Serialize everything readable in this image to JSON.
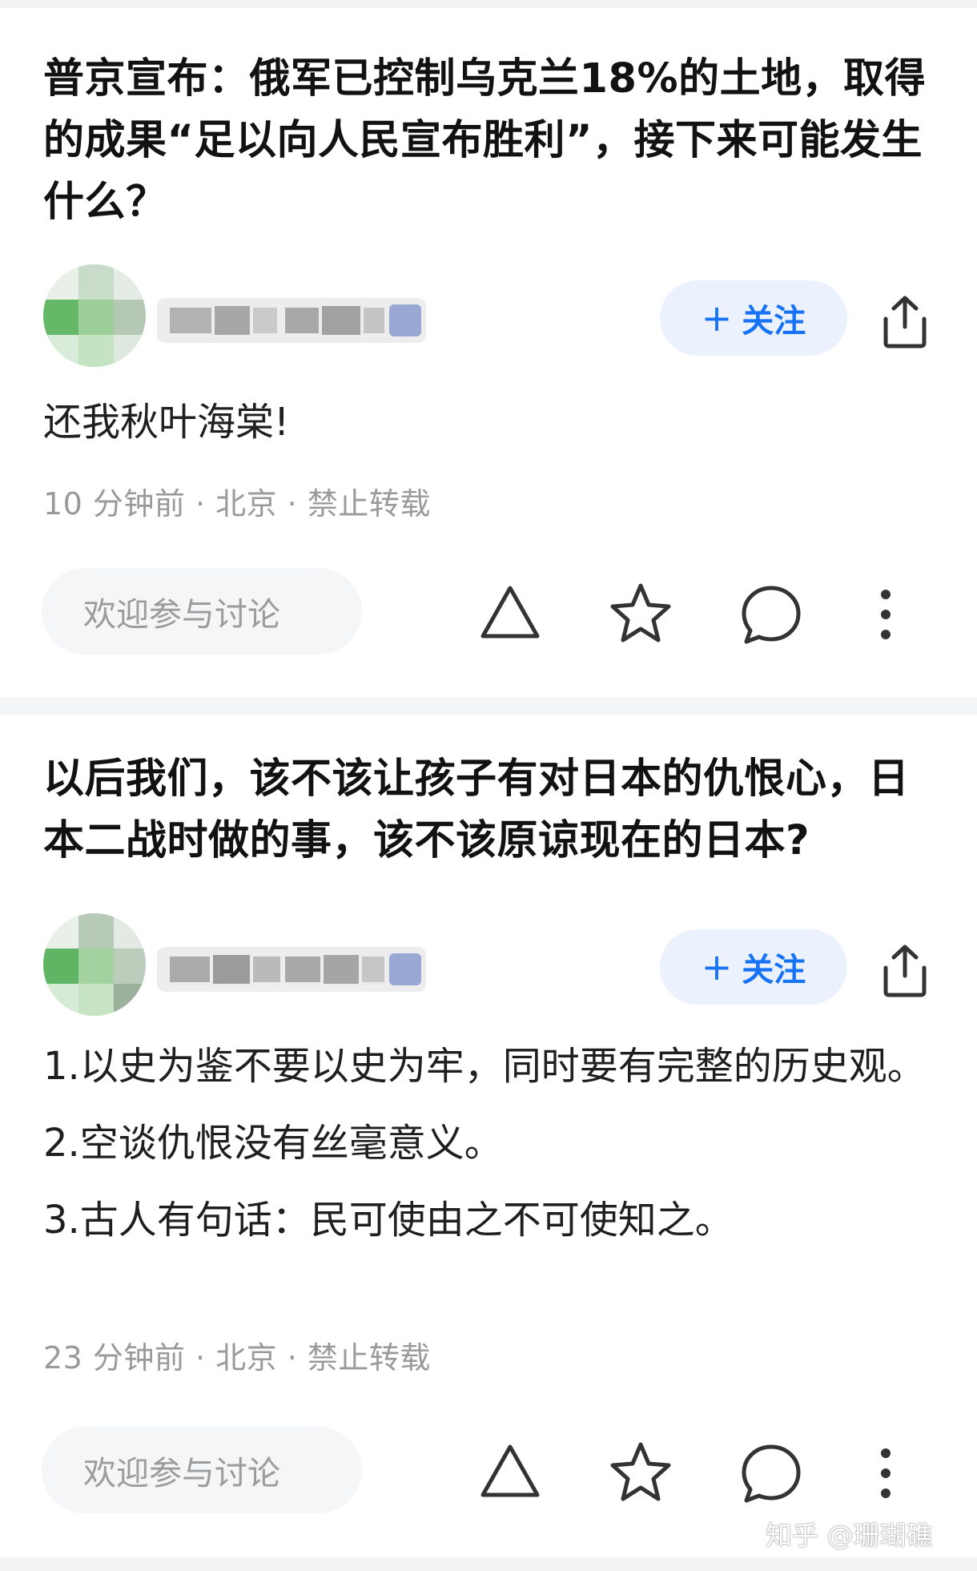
{
  "posts": [
    {
      "question_title": "普京宣布：俄军已控制乌克兰18%的土地，取得的成果“足以向人民宣布胜利”，接下来可能发生什么？",
      "follow_label": "关注",
      "answer_paragraphs": [
        "还我秋叶海棠!"
      ],
      "meta": "10 分钟前 · 北京 · 禁止转载",
      "comment_placeholder": "欢迎参与讨论"
    },
    {
      "question_title": "以后我们，该不该让孩子有对日本的仇恨心，日本二战时做的事，该不该原谅现在的日本?",
      "follow_label": "关注",
      "answer_paragraphs": [
        "1.以史为鉴不要以史为牢，同时要有完整的历史观。",
        "2.空谈仇恨没有丝毫意义。",
        "3.古人有句话：民可使由之不可使知之。"
      ],
      "meta": "23 分钟前 · 北京 · 禁止转载",
      "comment_placeholder": "欢迎参与讨论"
    }
  ],
  "watermark": "知乎 @珊瑚礁",
  "icons": {
    "follow": "plus-icon",
    "share": "share-icon",
    "upvote": "triangle-upvote-icon",
    "favorite": "star-icon",
    "comment": "speech-bubble-icon",
    "more": "vertical-dots-icon"
  },
  "colors": {
    "accent_blue": "#1772f6",
    "follow_bg": "#ebf2fe",
    "meta_gray": "#9a9a9a",
    "icon_dark": "#333333",
    "separator": "#f2f3f5"
  }
}
